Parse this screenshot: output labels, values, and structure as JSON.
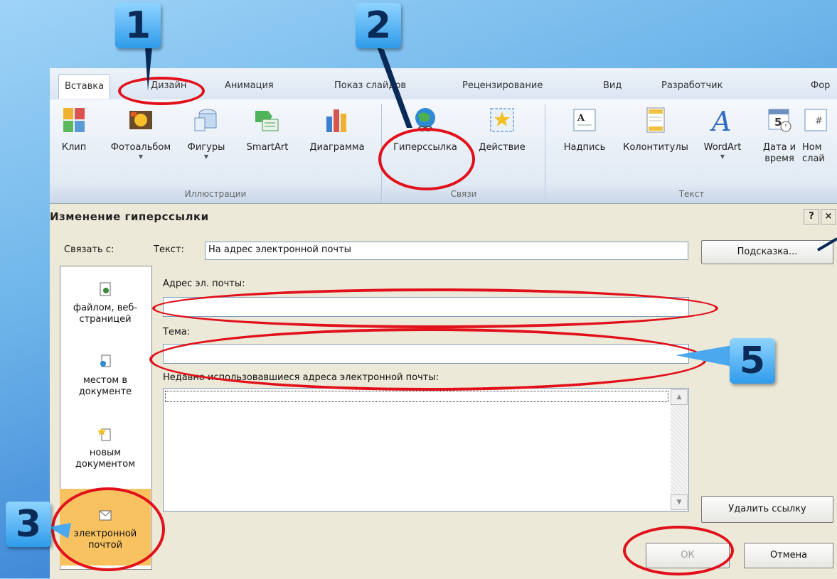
{
  "ribbon": {
    "tabs": [
      "Вставка",
      "Дизайн",
      "Анимация",
      "Показ слайдов",
      "Рецензирование",
      "Вид",
      "Разработчик",
      "Фор"
    ],
    "groups": {
      "illustrations": {
        "label": "Иллюстрации",
        "buttons": [
          "Клип",
          "Фотоальбом",
          "Фигуры",
          "SmartArt",
          "Диаграмма"
        ]
      },
      "links": {
        "label": "Связи",
        "buttons": [
          "Гиперссылка",
          "Действие"
        ]
      },
      "text": {
        "label": "Текст",
        "buttons": [
          "Надпись",
          "Колонтитулы",
          "WordArt",
          "Дата и",
          "время",
          "Ном",
          "слай"
        ]
      }
    }
  },
  "dialog": {
    "title": "Изменение гиперссылки",
    "help_btn": "?",
    "close_btn": "×",
    "link_to_label": "Связать с:",
    "text_label": "Текст:",
    "text_value": "На адрес электронной почты",
    "tip_btn": "Подсказка...",
    "email_label": "Адрес эл. почты:",
    "email_value": "",
    "subject_label": "Тема:",
    "subject_value": "",
    "recent_label": "Недавно использовавшиеся адреса электронной почты:",
    "link_items": [
      {
        "line1": "файлом, веб-",
        "line2": "страницей"
      },
      {
        "line1": "местом в",
        "line2": "документе"
      },
      {
        "line1": "новым",
        "line2": "документом"
      },
      {
        "line1": "электронной",
        "line2": "почтой"
      }
    ],
    "remove_btn": "Удалить ссылку",
    "ok_btn": "ОК",
    "cancel_btn": "Отмена"
  },
  "annotations": [
    "1",
    "2",
    "3",
    "5"
  ]
}
